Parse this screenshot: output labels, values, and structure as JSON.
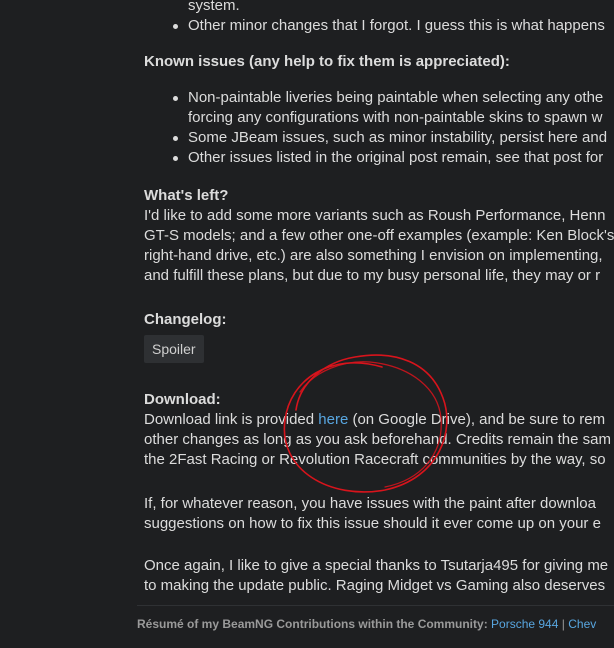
{
  "top_bullets": {
    "line_system": "system.",
    "item_forgot": "Other minor changes that I forgot. I guess this is what happens"
  },
  "known_issues": {
    "heading": "Known issues (any help to fix them is appreciated):",
    "items": [
      {
        "line1": "Non-paintable liveries being paintable when selecting any othe",
        "line2": "forcing any configurations with non-paintable skins to spawn w"
      },
      {
        "line1": "Some JBeam issues, such as minor instability, persist here and"
      },
      {
        "line1": "Other issues listed in the original post remain, see that post for"
      }
    ]
  },
  "whats_left": {
    "heading": "What's left?",
    "lines": [
      "I'd like to add some more variants such as Roush Performance, Henn",
      "GT-S models; and a few other one-off examples (example: Ken Block's",
      "right-hand drive, etc.) are also something I envision on implementing,",
      "and fulfill these plans, but due to my busy personal life, they may or r"
    ]
  },
  "changelog": {
    "heading": "Changelog:",
    "spoiler_label": "Spoiler"
  },
  "download": {
    "heading": "Download:",
    "line1_before": "Download link is provided ",
    "line1_link": "here",
    "line1_after": " (on Google Drive), and be sure to rem",
    "line2": "other changes as long as you ask beforehand. Credits remain the sam",
    "line3": "the 2Fast Racing or Revolution Racecraft communities by the way, so"
  },
  "paint_paragraph": {
    "lines": [
      "If, for whatever reason, you have issues with the paint after downloa",
      "suggestions on how to fix this issue should it ever come up on your e"
    ]
  },
  "thanks_paragraph": {
    "lines": [
      "Once again, I like to give a special thanks to Tsutarja495 for giving me",
      "to making the update public. Raging Midget vs Gaming also deserves"
    ]
  },
  "signature": {
    "label": "Résumé of my BeamNG Contributions within the Community:",
    "link1": "Porsche 944",
    "separator": "|",
    "link2": "Chev"
  },
  "colors": {
    "background": "#1e1f21",
    "text": "#dcdcdc",
    "link": "#58a6e0",
    "annotation": "#d8141c"
  }
}
